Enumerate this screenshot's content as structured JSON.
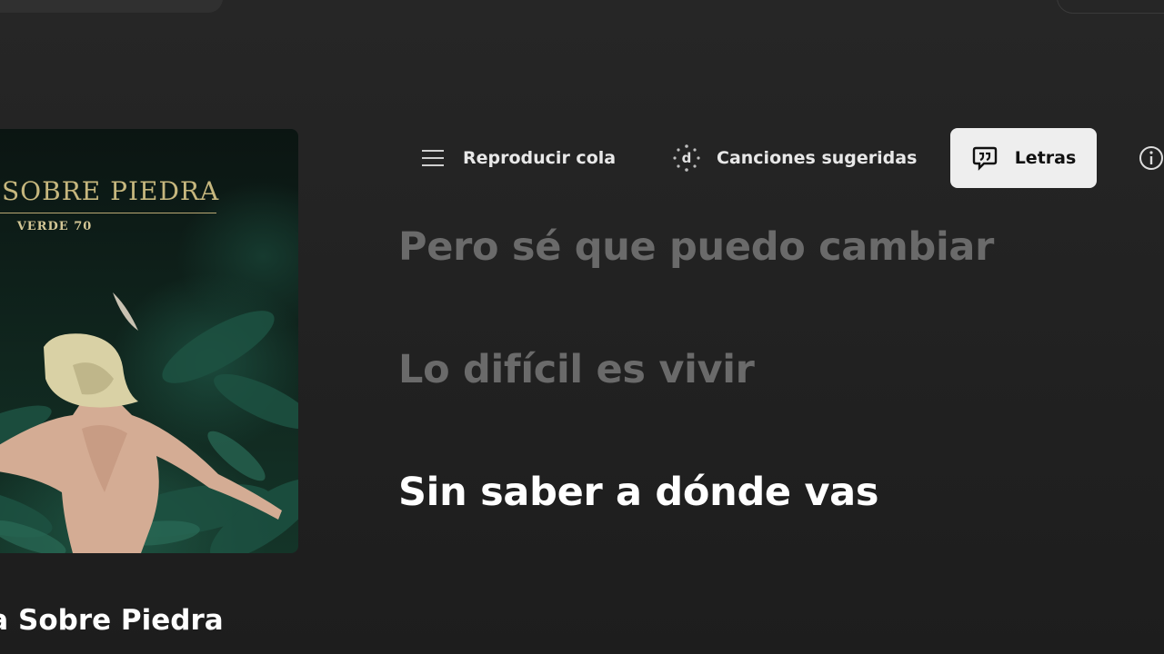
{
  "album": {
    "cover_title": "RA SOBRE PIEDRA",
    "cover_subtitle": "VERDE 70",
    "name": "ra Sobre Piedra"
  },
  "tabs": [
    {
      "label": "Reproducir cola",
      "icon": "queue-icon",
      "active": false
    },
    {
      "label": "Canciones sugeridas",
      "icon": "suggestions-icon",
      "active": false
    },
    {
      "label": "Letras",
      "icon": "lyrics-icon",
      "active": true
    },
    {
      "label": "",
      "icon": "info-icon",
      "active": false
    }
  ],
  "lyrics": [
    {
      "text": "Pero sé que puedo cambiar",
      "state": "past"
    },
    {
      "text": "Lo difícil es vivir",
      "state": "past"
    },
    {
      "text": "Sin saber a dónde vas",
      "state": "current"
    }
  ],
  "colors": {
    "background": "#232323",
    "active_tab_bg": "#eeeeee",
    "lyric_past": "#6a6a6a",
    "lyric_current": "#ffffff"
  }
}
